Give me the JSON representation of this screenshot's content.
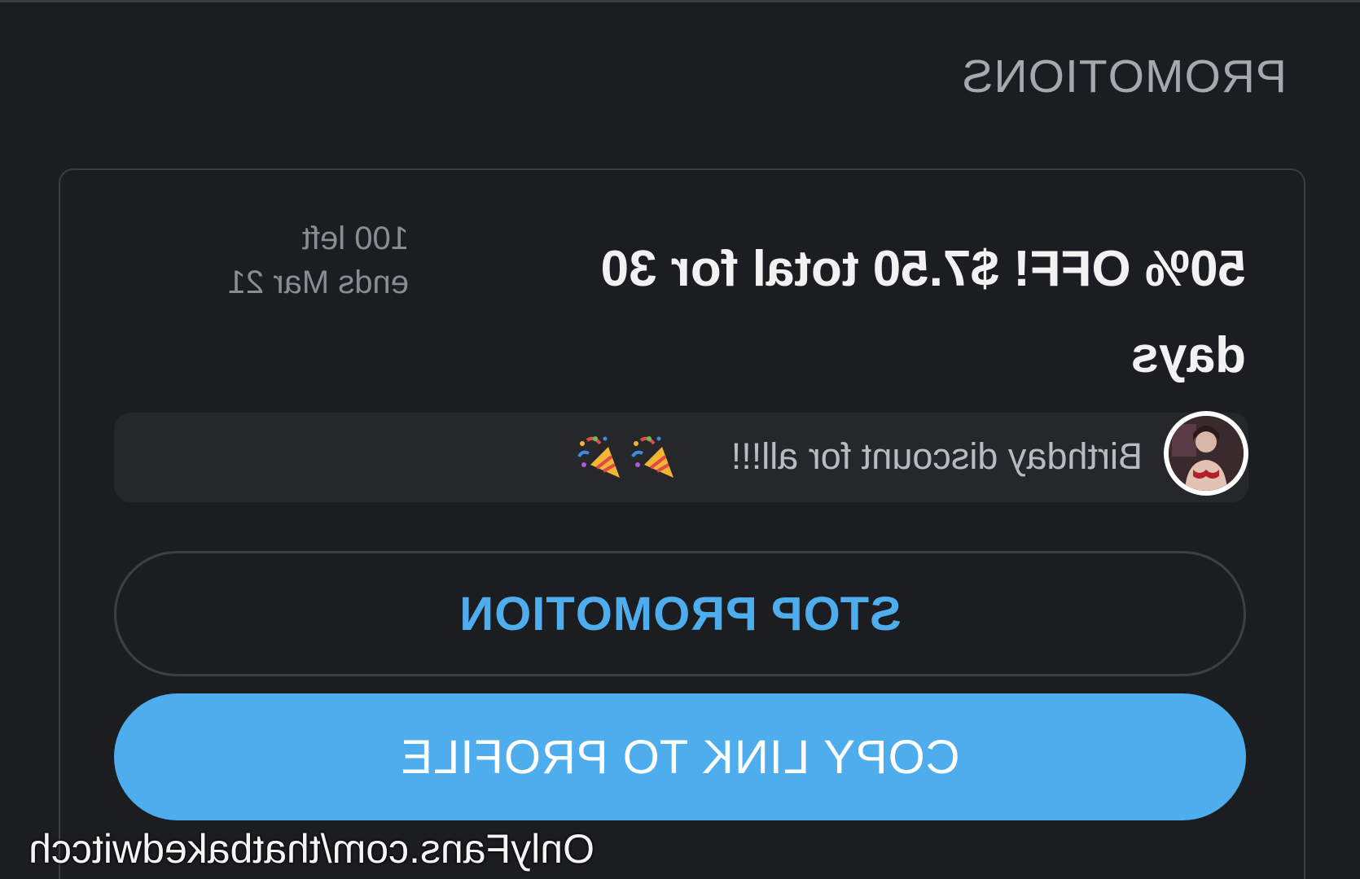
{
  "header": {
    "title": "PROMOTIONS"
  },
  "promotion": {
    "offer": "50% OFF! $7.50 total for 30 days",
    "remaining": "100 left",
    "ends": "ends Mar 21",
    "message": "Birthday discount for all!!!",
    "emoji_icons": [
      "party-popper-icon",
      "party-popper-icon"
    ]
  },
  "actions": {
    "stop_label": "STOP PROMOTION",
    "copy_label": "COPY LINK TO PROFILE"
  },
  "watermark": {
    "text": "OnlyFans.com/thatbakedwitcch"
  },
  "colors": {
    "background": "#1c1d20",
    "accent": "#4eadec",
    "card_border": "#3c3d41",
    "bubble": "#26272b",
    "muted_text": "#8a8c91"
  }
}
